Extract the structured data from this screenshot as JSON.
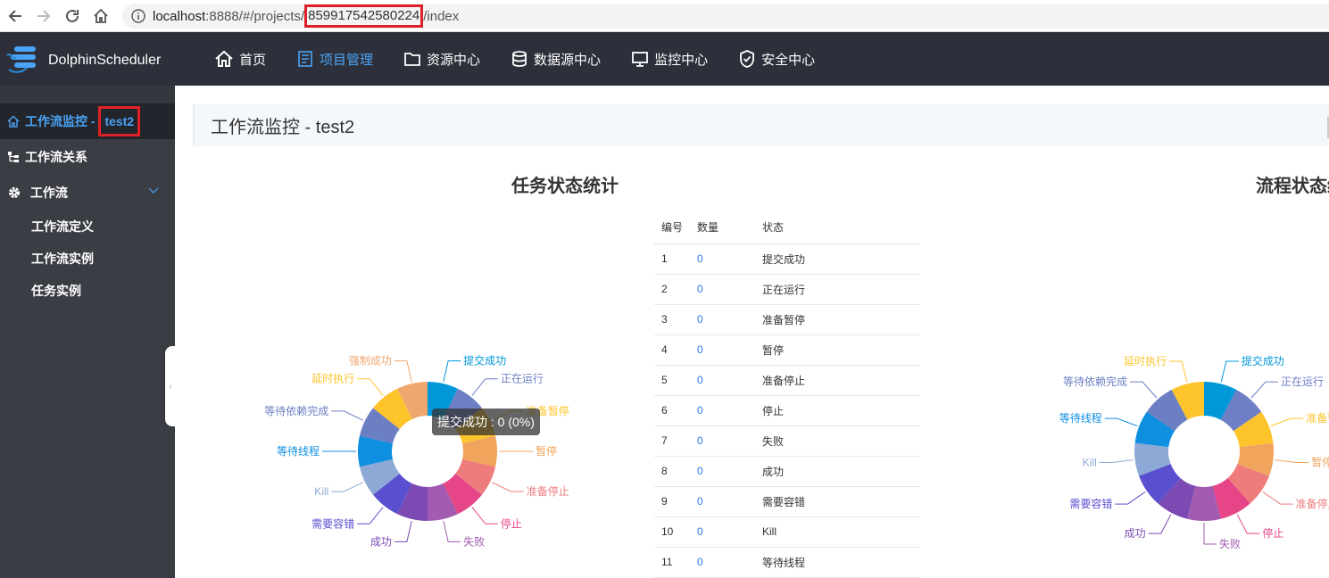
{
  "browser": {
    "url_prefix": "localhost",
    "url_mid": ":8888/#/projects/",
    "url_highlight": "859917542580224",
    "url_suffix": "/index"
  },
  "header": {
    "logo": "DolphinScheduler",
    "menu": [
      {
        "label": "首页",
        "icon": "home-icon",
        "active": false
      },
      {
        "label": "项目管理",
        "icon": "document-icon",
        "active": true
      },
      {
        "label": "资源中心",
        "icon": "folder-icon",
        "active": false
      },
      {
        "label": "数据源中心",
        "icon": "database-icon",
        "active": false
      },
      {
        "label": "监控中心",
        "icon": "monitor-icon",
        "active": false
      },
      {
        "label": "安全中心",
        "icon": "shield-icon",
        "active": false
      }
    ]
  },
  "sidebar": {
    "monitor_prefix": "工作流监控 -",
    "monitor_project": "test2",
    "relation": "工作流关系",
    "workflow": "工作流",
    "sub_items": [
      "工作流定义",
      "工作流实例",
      "任务实例"
    ]
  },
  "main": {
    "title": "工作流监控 - test2",
    "task_chart_title": "任务状态统计",
    "process_chart_title": "流程状态统计",
    "tooltip": "提交成功 : 0 (0%)",
    "table": {
      "headers": [
        "编号",
        "数量",
        "状态"
      ],
      "rows": [
        {
          "id": "1",
          "count": "0",
          "state": "提交成功"
        },
        {
          "id": "2",
          "count": "0",
          "state": "正在运行"
        },
        {
          "id": "3",
          "count": "0",
          "state": "准备暂停"
        },
        {
          "id": "4",
          "count": "0",
          "state": "暂停"
        },
        {
          "id": "5",
          "count": "0",
          "state": "准备停止"
        },
        {
          "id": "6",
          "count": "0",
          "state": "停止"
        },
        {
          "id": "7",
          "count": "0",
          "state": "失败"
        },
        {
          "id": "8",
          "count": "0",
          "state": "成功"
        },
        {
          "id": "9",
          "count": "0",
          "state": "需要容错"
        },
        {
          "id": "10",
          "count": "0",
          "state": "Kill"
        },
        {
          "id": "11",
          "count": "0",
          "state": "等待线程"
        }
      ]
    }
  },
  "chart_data": [
    {
      "type": "pie",
      "title": "任务状态统计",
      "categories": [
        "提交成功",
        "正在运行",
        "准备暂停",
        "暂停",
        "准备停止",
        "停止",
        "失败",
        "成功",
        "需要容错",
        "Kill",
        "等待线程",
        "等待依赖完成",
        "延时执行",
        "强制成功"
      ],
      "values": [
        0,
        0,
        0,
        0,
        0,
        0,
        0,
        0,
        0,
        0,
        0,
        0,
        0,
        0
      ],
      "colors": [
        "#0098d9",
        "#6f7fc6",
        "#fec42c",
        "#f0a45c",
        "#ee7c7d",
        "#e64588",
        "#a25bb0",
        "#7d4ab3",
        "#5a4fcf",
        "#8ea9d6",
        "#0e8fe0",
        "#6c7fc2",
        "#fec42c",
        "#f0a76e"
      ]
    },
    {
      "type": "pie",
      "title": "流程状态统计",
      "categories": [
        "提交成功",
        "正在运行",
        "准备暂停",
        "暂停",
        "准备停止",
        "停止",
        "失败",
        "成功",
        "需要容错",
        "Kill",
        "等待线程",
        "等待依赖完成",
        "延时执行"
      ],
      "values": [
        0,
        0,
        0,
        0,
        0,
        0,
        0,
        0,
        0,
        0,
        0,
        0,
        0
      ],
      "colors": [
        "#0098d9",
        "#6f7fc6",
        "#fec42c",
        "#f0a45c",
        "#ee7c7d",
        "#e64588",
        "#a25bb0",
        "#7d4ab3",
        "#5a4fcf",
        "#8ea9d6",
        "#0e8fe0",
        "#6c7fc2",
        "#fec42c"
      ]
    }
  ]
}
